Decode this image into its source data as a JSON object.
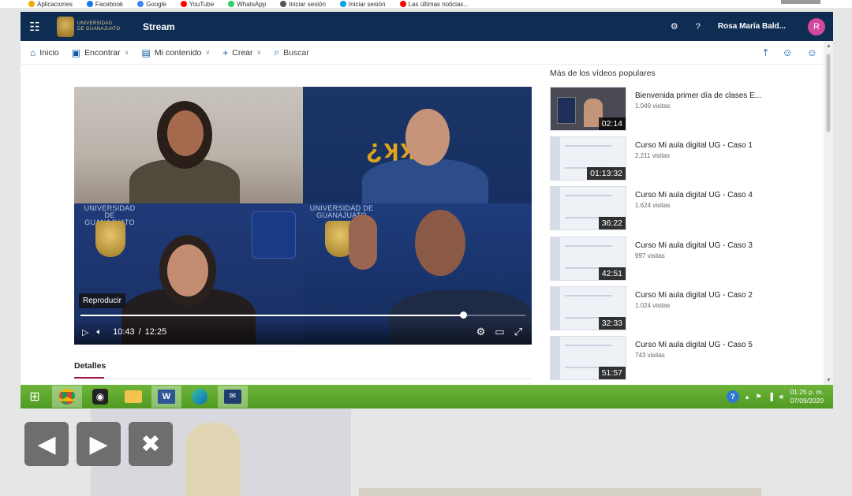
{
  "bookmarks": [
    {
      "label": "Aplicaciones",
      "color": "#f2a900"
    },
    {
      "label": "Facebook",
      "color": "#1877f2"
    },
    {
      "label": "Google",
      "color": "#4285f4"
    },
    {
      "label": "YouTube",
      "color": "#ff0000"
    },
    {
      "label": "WhatsApp",
      "color": "#25d366"
    },
    {
      "label": "Iniciar sesión",
      "color": "#555555"
    },
    {
      "label": "Iniciar sesión",
      "color": "#00a4ef"
    },
    {
      "label": "Las últimas noticias...",
      "color": "#ff0000"
    }
  ],
  "stream_bar": {
    "app_title": "Stream",
    "university": "UNIVERSIDAD DE GUANAJUATO",
    "settings_icon": "gear-icon",
    "help_label": "?",
    "user_name": "Rosa María Bald...",
    "avatar_initial": "R",
    "avatar_color": "#d3489c"
  },
  "nav": {
    "home": "Inicio",
    "discover": "Encontrar",
    "my_content": "Mi contenido",
    "create": "Crear",
    "search": "Buscar"
  },
  "video": {
    "tooltip": "Reproducir",
    "current_time": "10:43",
    "separator": "/",
    "total_time": "12:25",
    "progress_fraction": 0.86,
    "tile_text_university": "UNIVERSIDAD DE GUANAJUATO"
  },
  "details": {
    "tab_label": "Detalles"
  },
  "sidebar": {
    "title": "Más de los vídeos populares",
    "videos": [
      {
        "title": "Bienvenida primer día de clases E...",
        "views": "1.049 visitas",
        "duration": "02:14"
      },
      {
        "title": "Curso Mi aula digital UG - Caso 1",
        "views": "2.211 visitas",
        "duration": "01:13:32"
      },
      {
        "title": "Curso Mi aula digital UG - Caso 4",
        "views": "1.624 visitas",
        "duration": "36:22"
      },
      {
        "title": "Curso Mi aula digital UG - Caso 3",
        "views": "997 visitas",
        "duration": "42:51"
      },
      {
        "title": "Curso Mi aula digital UG - Caso 2",
        "views": "1.024 visitas",
        "duration": "32:33"
      },
      {
        "title": "Curso Mi aula digital UG - Caso 5",
        "views": "743 visitas",
        "duration": "51:57"
      }
    ]
  },
  "taskbar": {
    "time": "01:25 p. m.",
    "date": "07/09/2020",
    "apps": [
      "chrome-icon",
      "camera-icon",
      "file-explorer-icon",
      "word-icon",
      "edge-icon",
      "teams-icon"
    ]
  },
  "overlay_buttons": {
    "prev": "previous-arrow-icon",
    "next": "next-arrow-icon",
    "close": "close-icon"
  }
}
